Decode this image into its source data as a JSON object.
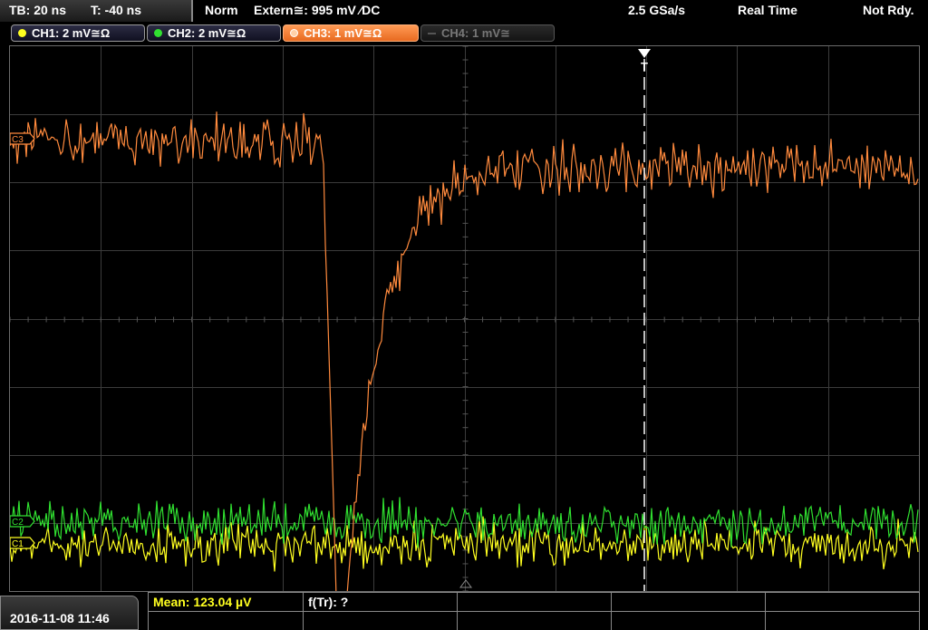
{
  "header": {
    "timebase": "TB: 20 ns",
    "trigger_time": "T: -40 ns",
    "acq_mode": "Norm",
    "trigger_info": "Extern≅: 995 mV ∕DC",
    "sample_rate": "2.5 GSa/s",
    "realtime": "Real Time",
    "status": "Not Rdy."
  },
  "channels": [
    {
      "label": "CH1: 2 mV≅Ω",
      "color": "#ffff20",
      "state": "on"
    },
    {
      "label": "CH2: 2 mV≅Ω",
      "color": "#30e030",
      "state": "on"
    },
    {
      "label": "CH3: 1 mV≅Ω",
      "color": "#ff8a3d",
      "state": "active"
    },
    {
      "label": "CH4: 1 mV≅",
      "color": "#777777",
      "state": "off"
    }
  ],
  "markers": {
    "trigger": "T",
    "ch3": "C3",
    "ch2": "C2",
    "ch1": "C1"
  },
  "footer": {
    "datetime": "2016-11-08 11:46",
    "mean": "Mean: 123.04 µV",
    "ftr": "f(Tr): ?"
  },
  "colors": {
    "ch1": "#ffff20",
    "ch2": "#30e030",
    "ch3": "#ff8a3d",
    "grid": "#3c3c3c"
  }
}
